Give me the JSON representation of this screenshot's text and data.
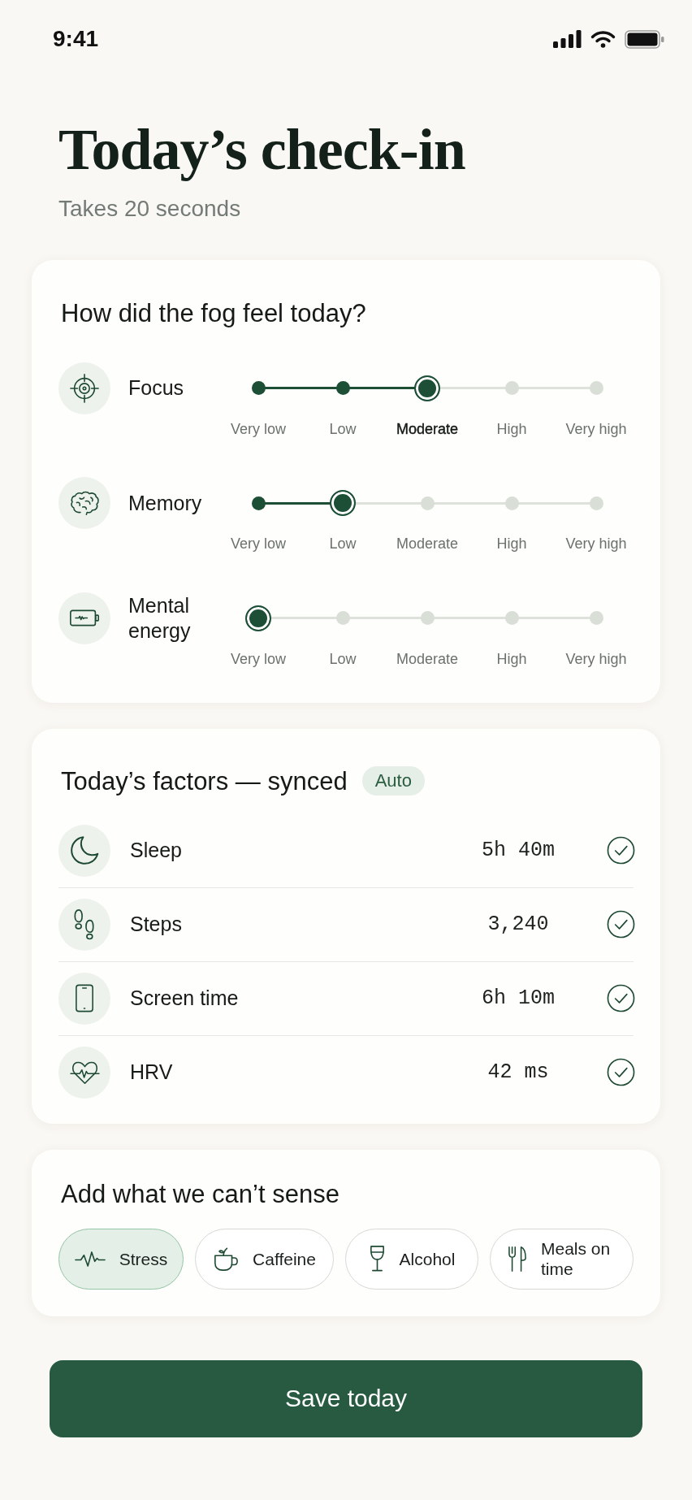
{
  "status_bar": {
    "time": "9:41"
  },
  "header": {
    "title": "Today’s check-in",
    "subtitle": "Takes 20 seconds"
  },
  "fog_card": {
    "title": "How did the fog feel today?",
    "ratings": [
      {
        "kind": "focus",
        "label": "Focus",
        "active": true,
        "options": [
          {
            "label": "Very low",
            "selected": false
          },
          {
            "label": "Low",
            "selected": false
          },
          {
            "label": "Moderate",
            "selected": true
          },
          {
            "label": "High",
            "selected": false
          },
          {
            "label": "Very high",
            "selected": false
          }
        ]
      },
      {
        "kind": "memory",
        "label": "Memory",
        "active": false,
        "options": [
          {
            "label": "Very low",
            "selected": false
          },
          {
            "label": "Low",
            "selected": true
          },
          {
            "label": "Moderate",
            "selected": false
          },
          {
            "label": "High",
            "selected": false
          },
          {
            "label": "Very high",
            "selected": false
          }
        ]
      },
      {
        "kind": "energy",
        "label": "Mental energy",
        "active": false,
        "options": [
          {
            "label": "Very low",
            "selected": true
          },
          {
            "label": "Low",
            "selected": false
          },
          {
            "label": "Moderate",
            "selected": false
          },
          {
            "label": "High",
            "selected": false
          },
          {
            "label": "Very high",
            "selected": false
          }
        ]
      }
    ]
  },
  "factors_card": {
    "title": "Today’s factors — synced",
    "badge": "Auto",
    "factors": [
      {
        "kind": "sleep",
        "label": "Sleep",
        "value": "5h 40m",
        "checked": true
      },
      {
        "kind": "steps",
        "label": "Steps",
        "value": "3,240",
        "checked": true
      },
      {
        "kind": "screen",
        "label": "Screen time",
        "value": "6h 10m",
        "checked": true
      },
      {
        "kind": "hrv",
        "label": "HRV",
        "value": "42 ms",
        "checked": true
      }
    ]
  },
  "extras_card": {
    "title": "Add what we can’t sense",
    "chips": [
      {
        "kind": "stress",
        "label": "Stress",
        "selected": true
      },
      {
        "kind": "caffeine",
        "label": "Caffeine",
        "selected": false
      },
      {
        "kind": "alcohol",
        "label": "Alcohol",
        "selected": false
      },
      {
        "kind": "meals",
        "label": "Meals on time",
        "selected": false
      }
    ]
  },
  "save_button": {
    "label": "Save today"
  }
}
